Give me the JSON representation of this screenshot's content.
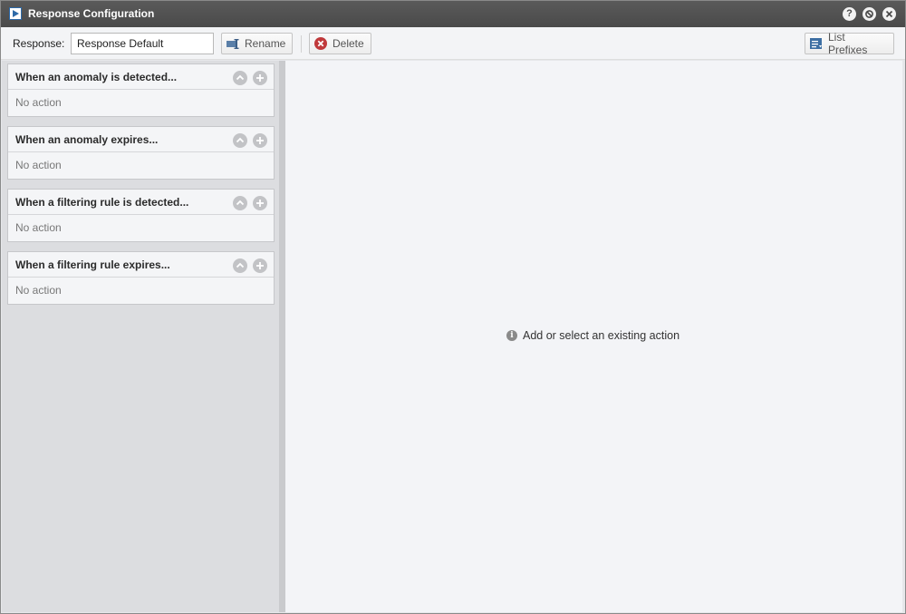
{
  "window": {
    "title": "Response Configuration"
  },
  "titlebar_buttons": [
    {
      "name": "help",
      "glyph": "?"
    },
    {
      "name": "minimize",
      "glyph": "⊘"
    },
    {
      "name": "close",
      "glyph": "✕"
    }
  ],
  "toolbar": {
    "response_label": "Response:",
    "response_value": "Response Default",
    "rename_label": "Rename",
    "delete_label": "Delete",
    "list_prefixes_label": "List Prefixes"
  },
  "triggers": [
    {
      "title": "When an anomaly is detected...",
      "body": "No action"
    },
    {
      "title": "When an anomaly expires...",
      "body": "No action"
    },
    {
      "title": "When a filtering rule is detected...",
      "body": "No action"
    },
    {
      "title": "When a filtering rule expires...",
      "body": "No action"
    }
  ],
  "main": {
    "hint": "Add or select an existing action"
  },
  "colors": {
    "titlebar": "#4f4f4f",
    "accent": "#2e6aa8",
    "delete_red": "#c0393b"
  }
}
